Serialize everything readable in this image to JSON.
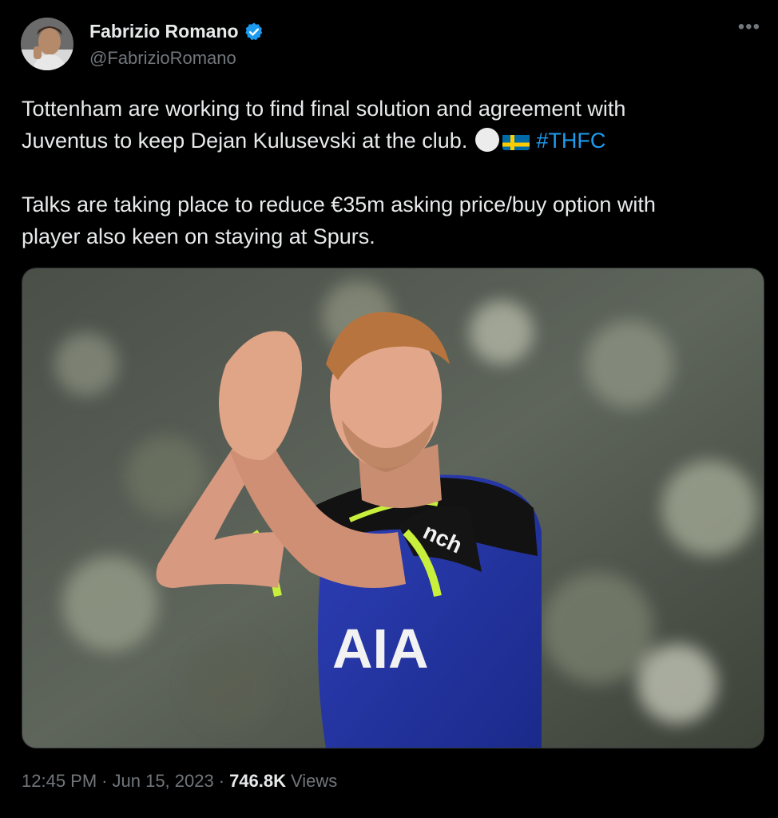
{
  "author": {
    "display_name": "Fabrizio Romano",
    "handle": "@FabrizioRomano",
    "verified": true,
    "avatar_icon": "avatar-photo"
  },
  "tweet": {
    "line1": "Tottenham are working to find final solution and agreement with",
    "line2": "Juventus to keep Dejan Kulusevski at the club.",
    "emoji_1": "white-circle-emoji",
    "emoji_2": "sweden-flag-emoji",
    "hashtag": "#THFC",
    "paragraph2_line1": "Talks are taking place to reduce €35m asking price/buy option with",
    "paragraph2_line2": "player also keen on staying at Spurs."
  },
  "media": {
    "type": "photo",
    "shirt_text": "AIA",
    "sleeve_text": "nch"
  },
  "meta": {
    "time": "12:45 PM",
    "separator": "·",
    "date": "Jun 15, 2023",
    "views_count": "746.8K",
    "views_label": "Views"
  },
  "colors": {
    "background": "#000000",
    "text": "#e7e9ea",
    "secondary": "#71767b",
    "link": "#1d9bf0",
    "verified": "#1d9bf0"
  },
  "icons": {
    "more": "more-icon",
    "verified": "verified-badge-icon"
  }
}
